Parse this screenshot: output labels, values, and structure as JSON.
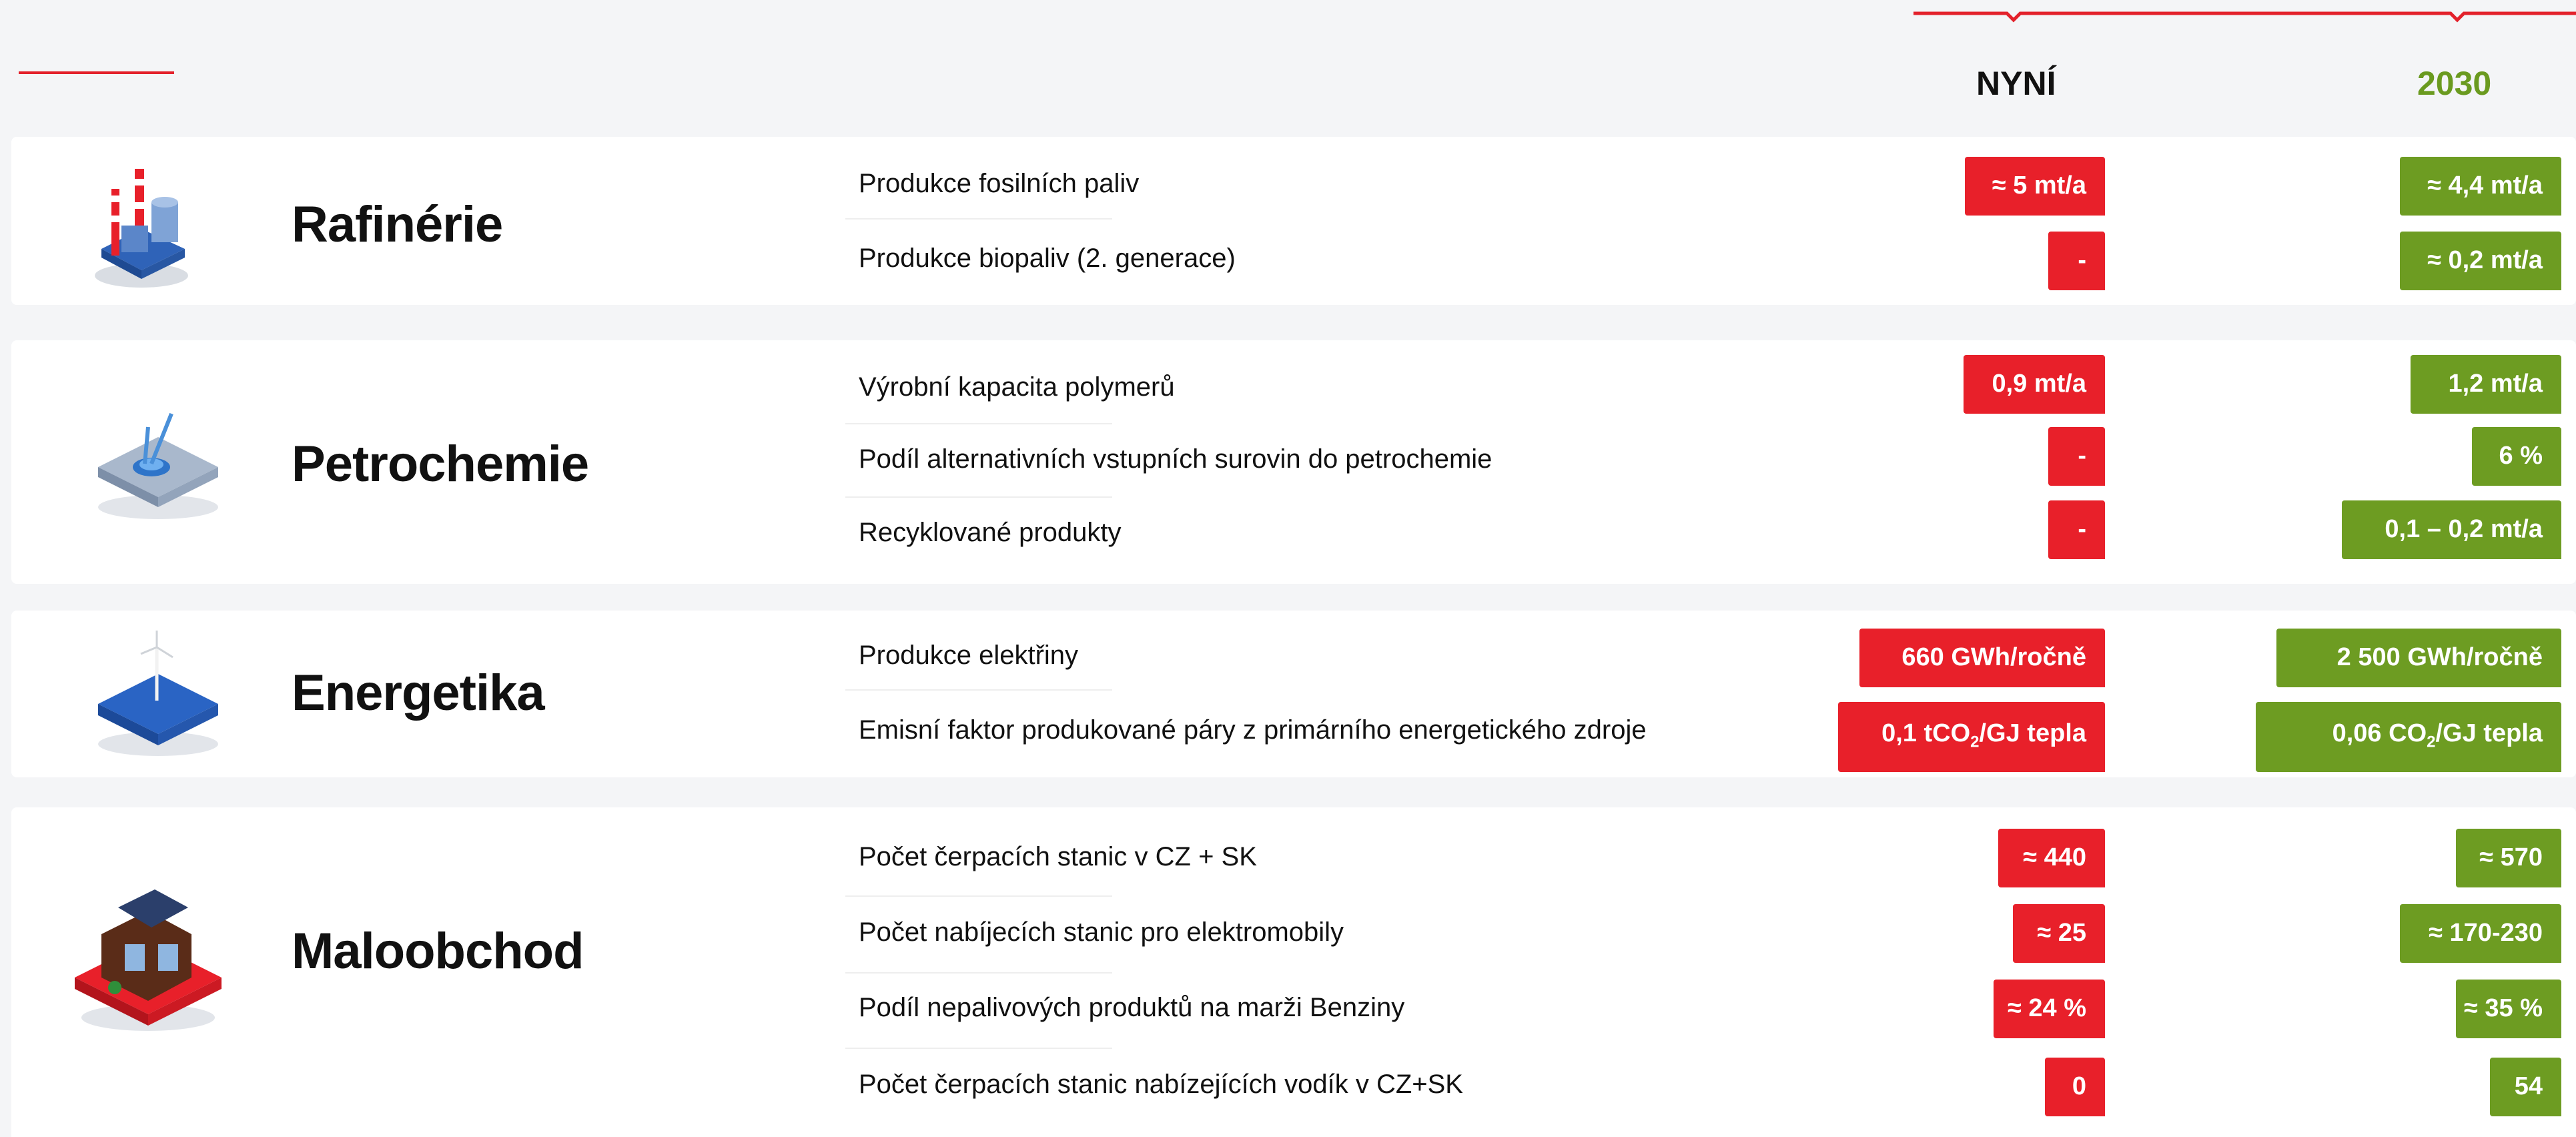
{
  "header": {
    "col_now": "NYNÍ",
    "col_2030": "2030"
  },
  "colors": {
    "red": "#e8202a",
    "green": "#6d9c22",
    "accent": "#e3212b"
  },
  "sections": [
    {
      "title": "Rafinérie",
      "icon": "refinery-icon",
      "rows": [
        {
          "label": "Produkce fosilních paliv",
          "now": "≈ 5 mt/a",
          "future": "≈ 4,4 mt/a"
        },
        {
          "label": "Produkce biopaliv (2. generace)",
          "now": "-",
          "future": "≈ 0,2 mt/a"
        }
      ]
    },
    {
      "title": "Petrochemie",
      "icon": "petrochemistry-icon",
      "rows": [
        {
          "label": "Výrobní kapacita polymerů",
          "now": "0,9 mt/a",
          "future": "1,2 mt/a"
        },
        {
          "label": "Podíl alternativních vstupních surovin do petrochemie",
          "now": "-",
          "future": "6 %"
        },
        {
          "label": "Recyklované produkty",
          "now": "-",
          "future": "0,1 – 0,2 mt/a"
        }
      ]
    },
    {
      "title": "Energetika",
      "icon": "wind-turbine-icon",
      "rows": [
        {
          "label": "Produkce elektřiny",
          "now": "660 GWh/ročně",
          "future": "2 500 GWh/ročně"
        },
        {
          "label": "Emisní faktor produkované páry z primárního energetického zdroje",
          "now_pre": "0,1 tCO",
          "now_sub": "2",
          "now_post": "/GJ tepla",
          "future_pre": "0,06 CO",
          "future_sub": "2",
          "future_post": "/GJ tepla"
        }
      ]
    },
    {
      "title": "Maloobchod",
      "icon": "gas-station-icon",
      "rows": [
        {
          "label": "Počet čerpacích stanic v CZ + SK",
          "now": "≈ 440",
          "future": "≈ 570"
        },
        {
          "label": "Počet nabíjecích stanic pro elektromobily",
          "now": "≈ 25",
          "future": "≈ 170-230"
        },
        {
          "label": "Podíl nepalivových produktů na marži Benziny",
          "now": "≈ 24 %",
          "future": "≈ 35 %"
        },
        {
          "label": "Počet čerpacích stanic nabízejících vodík v CZ+SK",
          "now": "0",
          "future": "54"
        }
      ]
    }
  ]
}
